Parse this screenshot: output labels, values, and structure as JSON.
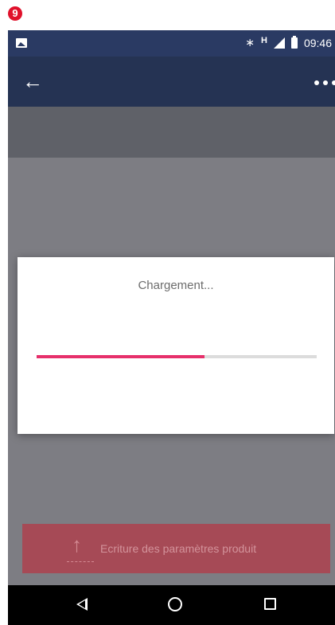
{
  "step_badge": "9",
  "status_bar": {
    "network": "H",
    "time": "09:46"
  },
  "dialog": {
    "title": "Chargement...",
    "progress": 0.6
  },
  "action_button": {
    "label": "Ecriture des paramètres produit"
  },
  "colors": {
    "app_bar": "#253353",
    "status_bar": "#2a3a63",
    "progress_fill": "#e6306b",
    "progress_track": "#dcdcdc",
    "action_button": "#a64a56"
  }
}
